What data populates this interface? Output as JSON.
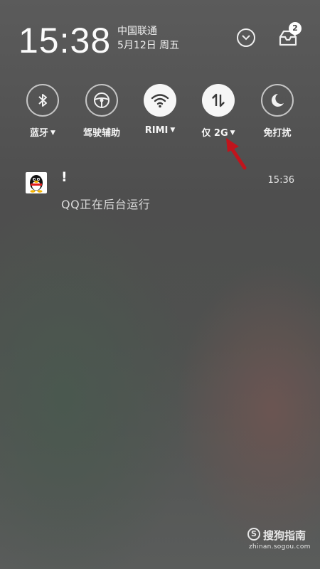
{
  "status": {
    "time": "15:38",
    "carrier": "中国联通",
    "date": "5月12日 周五",
    "notification_count": "2"
  },
  "toggles": [
    {
      "label": "蓝牙",
      "icon": "bluetooth-icon",
      "state": "off",
      "has_menu": true
    },
    {
      "label": "驾驶辅助",
      "icon": "steering-wheel-icon",
      "state": "off",
      "has_menu": false
    },
    {
      "label": "RIMI",
      "icon": "wifi-icon",
      "state": "on",
      "has_menu": true
    },
    {
      "label": "仅 2G",
      "icon": "mobile-data-icon",
      "state": "on",
      "has_menu": true
    },
    {
      "label": "免打扰",
      "icon": "moon-icon",
      "state": "off",
      "has_menu": false
    }
  ],
  "notification": {
    "title": "!",
    "time": "15:36",
    "text": "QQ正在后台运行",
    "app_icon": "qq-penguin-icon"
  },
  "watermark": {
    "logo": "S",
    "name": "搜狗指南",
    "url": "zhinan.sogou.com"
  },
  "colors": {
    "annotation_arrow": "#c0141c",
    "toggle_on_bg": "#f6f6f6",
    "toggle_on_icon": "#3a3a3a"
  }
}
